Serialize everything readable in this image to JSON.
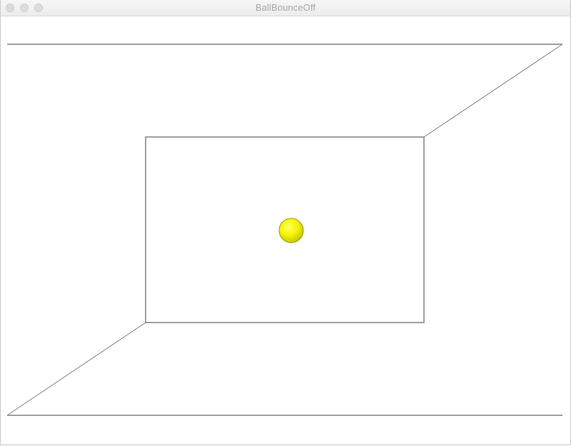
{
  "window": {
    "title": "BallBounceOff",
    "controls": {
      "close_icon": "close-dot",
      "minimize_icon": "minimize-dot",
      "zoom_icon": "zoom-dot"
    }
  },
  "scene": {
    "line_color": "#808080",
    "ball_color": "#f5f500",
    "ball_edge_color": "#9a9a00"
  }
}
